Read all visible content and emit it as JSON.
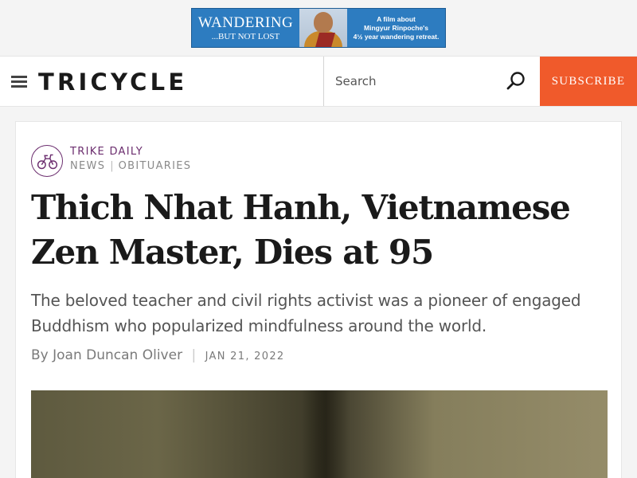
{
  "ad": {
    "title": "WANDERING",
    "subtitle": "...BUT NOT LOST",
    "text_line1": "A film about",
    "text_line2": "Mingyur Rinpoche's",
    "text_line3": "4½ year wandering retreat."
  },
  "header": {
    "logo": "TRICYCLE",
    "search_placeholder": "Search",
    "subscribe_label": "SUBSCRIBE",
    "accent_color": "#f05a2b"
  },
  "article": {
    "section": "TRIKE DAILY",
    "categories": [
      "NEWS",
      "OBITUARIES"
    ],
    "headline": "Thich Nhat Hanh, Vietnamese Zen Master, Dies at 95",
    "dek": "The beloved teacher and civil rights activist was a pioneer of engaged Buddhism who popularized mindfulness around the world.",
    "byline_prefix": "By",
    "author": "Joan Duncan Oliver",
    "date": "JAN 21, 2022",
    "section_color": "#6b2d6e"
  }
}
